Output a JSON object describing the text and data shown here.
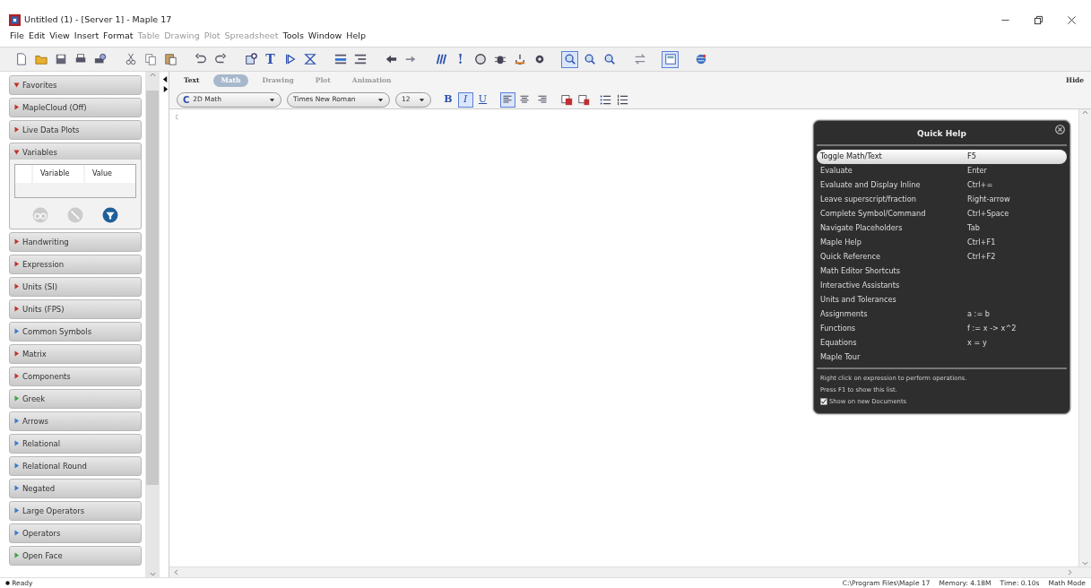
{
  "window": {
    "title": "Untitled (1) - [Server 1] - Maple 17"
  },
  "menu": [
    {
      "label": "File",
      "disabled": false
    },
    {
      "label": "Edit",
      "disabled": false
    },
    {
      "label": "View",
      "disabled": false
    },
    {
      "label": "Insert",
      "disabled": false
    },
    {
      "label": "Format",
      "disabled": false
    },
    {
      "label": "Table",
      "disabled": true
    },
    {
      "label": "Drawing",
      "disabled": true
    },
    {
      "label": "Plot",
      "disabled": true
    },
    {
      "label": "Spreadsheet",
      "disabled": true
    },
    {
      "label": "Tools",
      "disabled": false
    },
    {
      "label": "Window",
      "disabled": false
    },
    {
      "label": "Help",
      "disabled": false
    }
  ],
  "toolbar": [
    [
      {
        "selected": false
      },
      {
        "selected": false
      },
      {
        "selected": false
      },
      {
        "selected": false
      },
      {
        "selected": false
      }
    ],
    [
      {
        "selected": false
      },
      {
        "selected": false
      },
      {
        "selected": false
      }
    ],
    [
      {
        "selected": false
      },
      {
        "selected": false
      }
    ],
    [
      {
        "selected": false
      },
      {
        "glyph": "T",
        "selected": false
      },
      {
        "selected": false
      },
      {
        "selected": false
      }
    ],
    [
      {
        "selected": false
      },
      {
        "selected": false
      }
    ],
    [
      {
        "selected": false
      },
      {
        "selected": false
      }
    ],
    [
      {
        "selected": false
      },
      {
        "glyph": "!",
        "selected": false
      },
      {
        "selected": false
      },
      {
        "selected": false
      },
      {
        "selected": false
      },
      {
        "selected": false
      }
    ],
    [
      {
        "selected": true
      },
      {
        "selected": false
      },
      {
        "selected": false
      }
    ],
    [
      {
        "selected": false
      }
    ],
    [
      {
        "selected": true
      }
    ],
    [
      {
        "selected": false
      }
    ]
  ],
  "palettes": [
    {
      "label": "Favorites",
      "expanded": true,
      "color": "#c0302a"
    },
    {
      "label": "MapleCloud (Off)",
      "expanded": false,
      "color": "#c0302a"
    },
    {
      "label": "Live Data Plots",
      "expanded": false,
      "color": "#c0302a"
    },
    {
      "label": "Variables",
      "expanded": true,
      "color": "#c0302a",
      "columns": [
        "Variable",
        "Value"
      ]
    },
    {
      "label": "Handwriting",
      "expanded": false,
      "color": "#c0302a"
    },
    {
      "label": "Expression",
      "expanded": false,
      "color": "#c0302a"
    },
    {
      "label": "Units (SI)",
      "expanded": false,
      "color": "#c0302a"
    },
    {
      "label": "Units (FPS)",
      "expanded": false,
      "color": "#c0302a"
    },
    {
      "label": "Common Symbols",
      "expanded": false,
      "color": "#3a78c8"
    },
    {
      "label": "Matrix",
      "expanded": false,
      "color": "#c0302a"
    },
    {
      "label": "Components",
      "expanded": false,
      "color": "#c0302a"
    },
    {
      "label": "Greek",
      "expanded": false,
      "color": "#3aa040"
    },
    {
      "label": "Arrows",
      "expanded": false,
      "color": "#3a78c8"
    },
    {
      "label": "Relational",
      "expanded": false,
      "color": "#3a78c8"
    },
    {
      "label": "Relational Round",
      "expanded": false,
      "color": "#3a78c8"
    },
    {
      "label": "Negated",
      "expanded": false,
      "color": "#3a78c8"
    },
    {
      "label": "Large Operators",
      "expanded": false,
      "color": "#3a78c8"
    },
    {
      "label": "Operators",
      "expanded": false,
      "color": "#3a78c8"
    },
    {
      "label": "Open Face",
      "expanded": false,
      "color": "#3aa040"
    }
  ],
  "context_tabs": [
    {
      "label": "Text",
      "selected": false
    },
    {
      "label": "Math",
      "selected": true
    },
    {
      "label": "Drawing",
      "selected": false
    },
    {
      "label": "Plot",
      "selected": false
    },
    {
      "label": "Animation",
      "selected": false
    }
  ],
  "hide_label": "Hide",
  "format_bar": {
    "mode_glyph": "C",
    "mode": "2D Math",
    "font": "Times New Roman",
    "size": "12",
    "styles": [
      {
        "glyph": "B",
        "kind": "bold",
        "selected": false
      },
      {
        "glyph": "I",
        "kind": "italic",
        "selected": true
      },
      {
        "glyph": "U",
        "kind": "underline",
        "selected": false
      }
    ],
    "alignments": [
      {
        "selected": true
      },
      {
        "selected": false
      },
      {
        "selected": false
      }
    ]
  },
  "quick_help": {
    "title": "Quick Help",
    "rows": [
      {
        "label": "Toggle Math/Text",
        "shortcut": "F5",
        "selected": true
      },
      {
        "label": "Evaluate",
        "shortcut": "Enter",
        "selected": false
      },
      {
        "label": "Evaluate and Display Inline",
        "shortcut": "Ctrl+=",
        "selected": false
      },
      {
        "label": "Leave superscript/fraction",
        "shortcut": "Right-arrow",
        "selected": false
      },
      {
        "label": "Complete Symbol/Command",
        "shortcut": "Ctrl+Space",
        "selected": false
      },
      {
        "label": "Navigate Placeholders",
        "shortcut": "Tab",
        "selected": false
      },
      {
        "label": "Maple Help",
        "shortcut": "Ctrl+F1",
        "selected": false
      },
      {
        "label": "Quick Reference",
        "shortcut": "Ctrl+F2",
        "selected": false
      },
      {
        "label": "Math Editor Shortcuts",
        "selected": false
      },
      {
        "label": "Interactive Assistants",
        "selected": false
      },
      {
        "label": "Units and Tolerances",
        "selected": false
      },
      {
        "label": "Assignments",
        "shortcut": "a := b",
        "selected": false
      },
      {
        "label": "Functions",
        "shortcut": "f := x -> x^2",
        "selected": false
      },
      {
        "label": "Equations",
        "shortcut": "x = y",
        "selected": false
      },
      {
        "label": "Maple Tour",
        "selected": false
      }
    ],
    "notes": [
      "Right click on expression to perform operations.",
      "Press F1 to show this list."
    ],
    "checkbox": {
      "label": "Show on new Documents",
      "checked": true
    }
  },
  "status_bar": {
    "state": "Ready",
    "path": "C:\\Program Files\\Maple 17",
    "memory": "Memory: 4.18M",
    "time": "Time: 0.10s",
    "mode": "Math Mode"
  }
}
